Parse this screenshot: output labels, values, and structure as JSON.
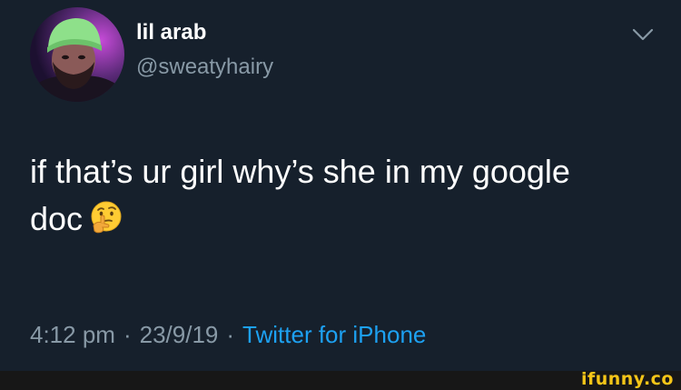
{
  "author": {
    "display_name": "lil arab",
    "handle": "@sweatyhairy"
  },
  "tweet": {
    "text_line_1": "if that’s ur girl why’s she in my google",
    "text_line_2": "doc",
    "emoji": "thinking-face"
  },
  "meta": {
    "time": "4:12 pm",
    "separator": "·",
    "date": "23/9/19",
    "source": "Twitter for iPhone"
  },
  "watermark": {
    "text": "ifunny.co"
  },
  "colors": {
    "background": "#16202c",
    "text": "#ffffff",
    "secondary_text": "#8899a6",
    "link": "#1da1f2",
    "watermark": "#f5c518"
  }
}
